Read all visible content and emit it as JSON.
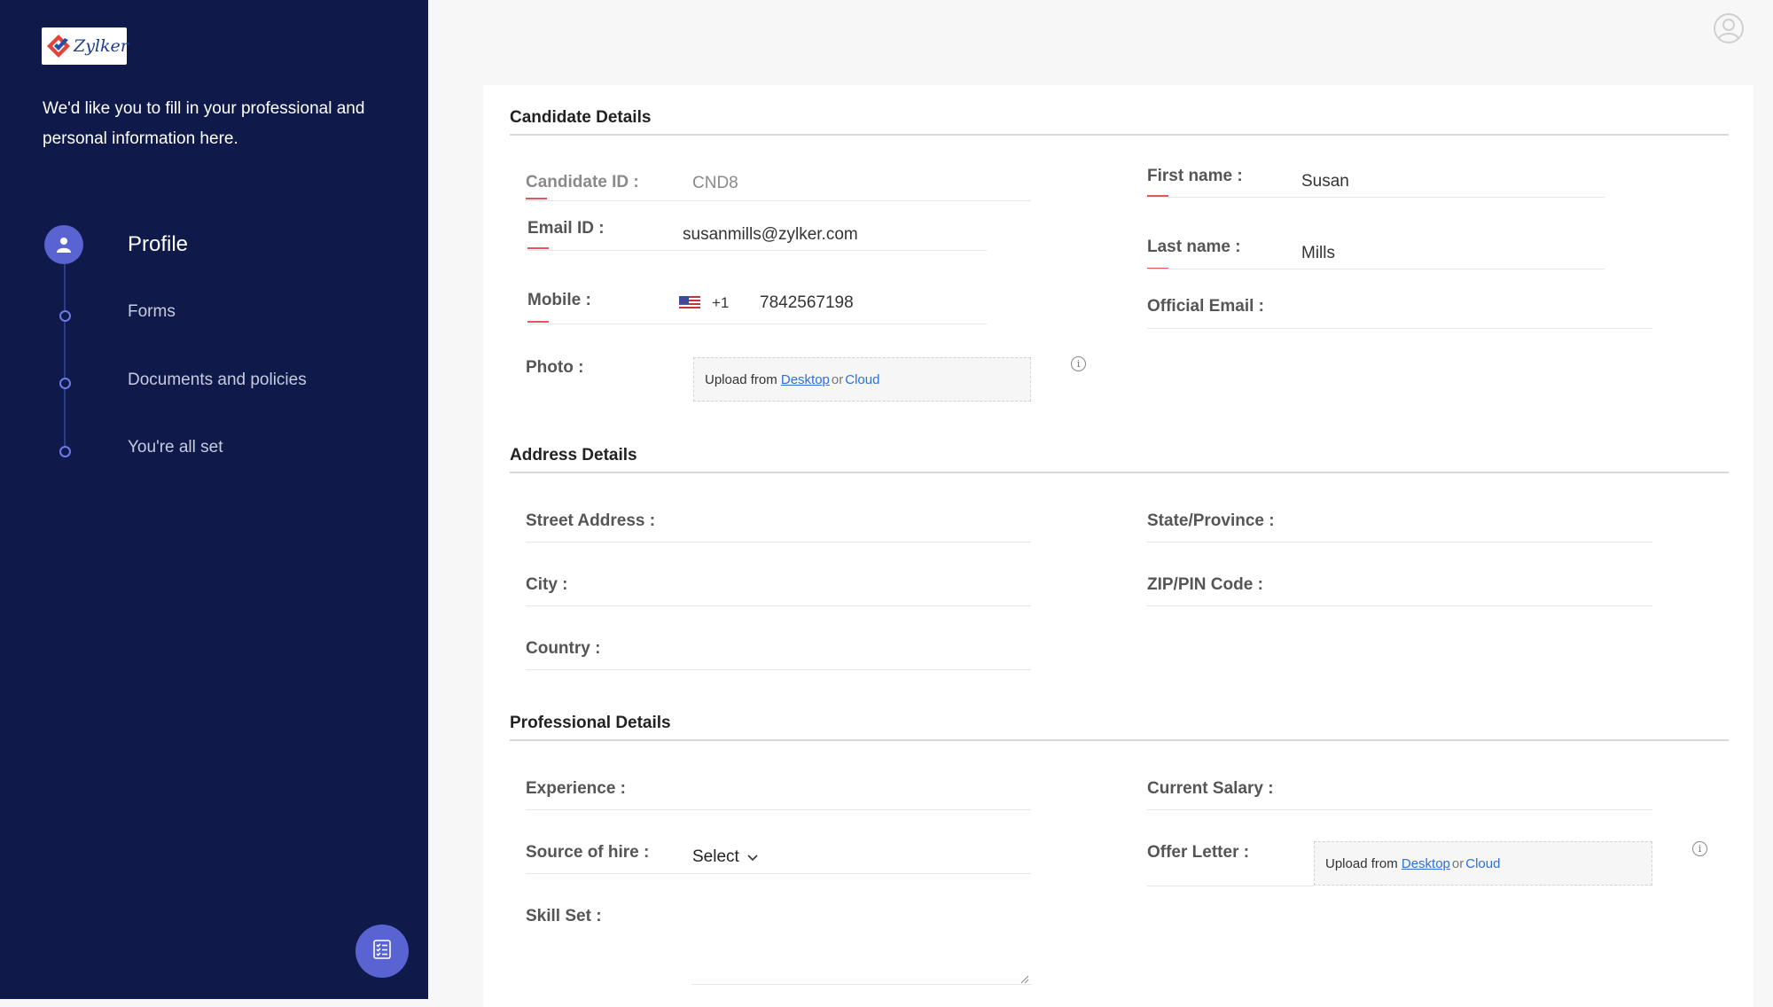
{
  "brand": {
    "logo_text": "Zylker"
  },
  "sidebar": {
    "intro": "We'd like you to fill in your professional and personal information here.",
    "steps": [
      {
        "label": "Profile",
        "active": true
      },
      {
        "label": "Forms",
        "active": false
      },
      {
        "label": "Documents and policies",
        "active": false
      },
      {
        "label": "You're all set",
        "active": false
      }
    ]
  },
  "candidate": {
    "title": "Candidate Details",
    "candidate_id_label": "Candidate ID :",
    "candidate_id_value": "CND8",
    "first_name_label": "First name :",
    "first_name_value": "Susan",
    "email_label": "Email ID :",
    "email_value": "susanmills@zylker.com",
    "last_name_label": "Last name :",
    "last_name_value": "Mills",
    "mobile_label": "Mobile :",
    "mobile_code": "+1",
    "mobile_value": "7842567198",
    "official_email_label": "Official Email :",
    "photo_label": "Photo :"
  },
  "upload": {
    "prefix": "Upload from",
    "desktop": "Desktop",
    "or": "or",
    "cloud": "Cloud"
  },
  "address": {
    "title": "Address Details",
    "street_label": "Street Address :",
    "state_label": "State/Province :",
    "city_label": "City :",
    "zip_label": "ZIP/PIN Code :",
    "country_label": "Country :"
  },
  "professional": {
    "title": "Professional Details",
    "experience_label": "Experience :",
    "salary_label": "Current Salary :",
    "source_label": "Source of hire :",
    "source_value": "Select",
    "offer_label": "Offer Letter :",
    "skill_label": "Skill Set :"
  },
  "icons": {
    "user": "user-avatar-icon",
    "info": "info-icon",
    "flag": "us-flag-icon",
    "checklist": "checklist-icon"
  },
  "colors": {
    "sidebar": "#0f1a4b",
    "accent": "#5963d1",
    "required": "#e0585e",
    "link": "#2e6fd8"
  }
}
